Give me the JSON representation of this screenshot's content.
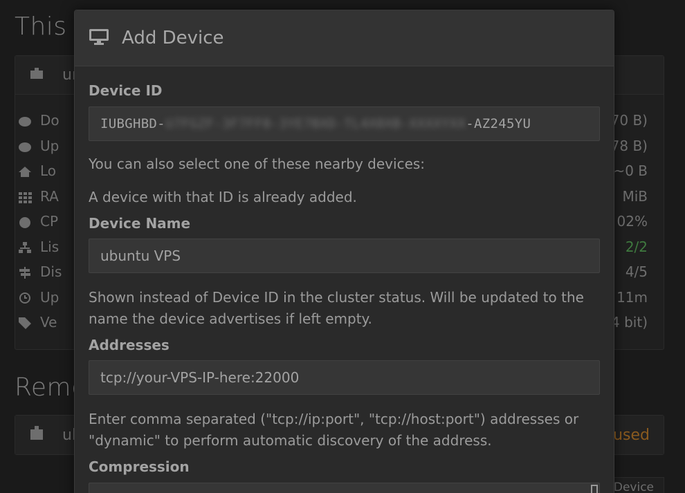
{
  "background": {
    "this_device_title": "This D",
    "this_device_panel_name": "ur",
    "rows": [
      {
        "label": "Do",
        "value": "70 B)",
        "icon": "cloud-download-icon"
      },
      {
        "label": "Up",
        "value": "78 B)",
        "icon": "cloud-upload-icon"
      },
      {
        "label": "Lo",
        "value": "~0 B",
        "icon": "home-icon"
      },
      {
        "label": "RA",
        "value": "MiB",
        "icon": "ram-grid-icon"
      },
      {
        "label": "CP",
        "value": "02%",
        "icon": "dashboard-icon"
      },
      {
        "label": "Lis",
        "value": "2/2",
        "icon": "sitemap-icon"
      },
      {
        "label": "Dis",
        "value": "4/5",
        "icon": "signpost-icon"
      },
      {
        "label": "Up",
        "value": "11m",
        "icon": "clock-icon"
      },
      {
        "label": "Ve",
        "value": "4 bit)",
        "icon": "tag-icon"
      }
    ],
    "remote_title": "Remo",
    "remote_panel_name": "ub",
    "remote_status": "used",
    "device_button_fragment": "Device"
  },
  "modal": {
    "title": "Add Device",
    "icon": "desktop-icon",
    "device_id": {
      "label": "Device ID",
      "prefix": "IUBGHBD-",
      "hidden_middle": "U7FGZF-3F7FF0-3YE7BXD-TL4X0XB-XXXXYXX",
      "suffix": "-AZ245YU"
    },
    "nearby_text": "You can also select one of these nearby devices:",
    "already_added_text": "A device with that ID is already added.",
    "device_name": {
      "label": "Device Name",
      "value": "ubuntu VPS",
      "help": "Shown instead of Device ID in the cluster status. Will be updated to the name the device advertises if left empty."
    },
    "addresses": {
      "label": "Addresses",
      "value": "tcp://your-VPS-IP-here:22000",
      "help": "Enter comma separated (\"tcp://ip:port\", \"tcp://host:port\") addresses or \"dynamic\" to perform automatic discovery of the address."
    },
    "compression": {
      "label": "Compression"
    }
  }
}
